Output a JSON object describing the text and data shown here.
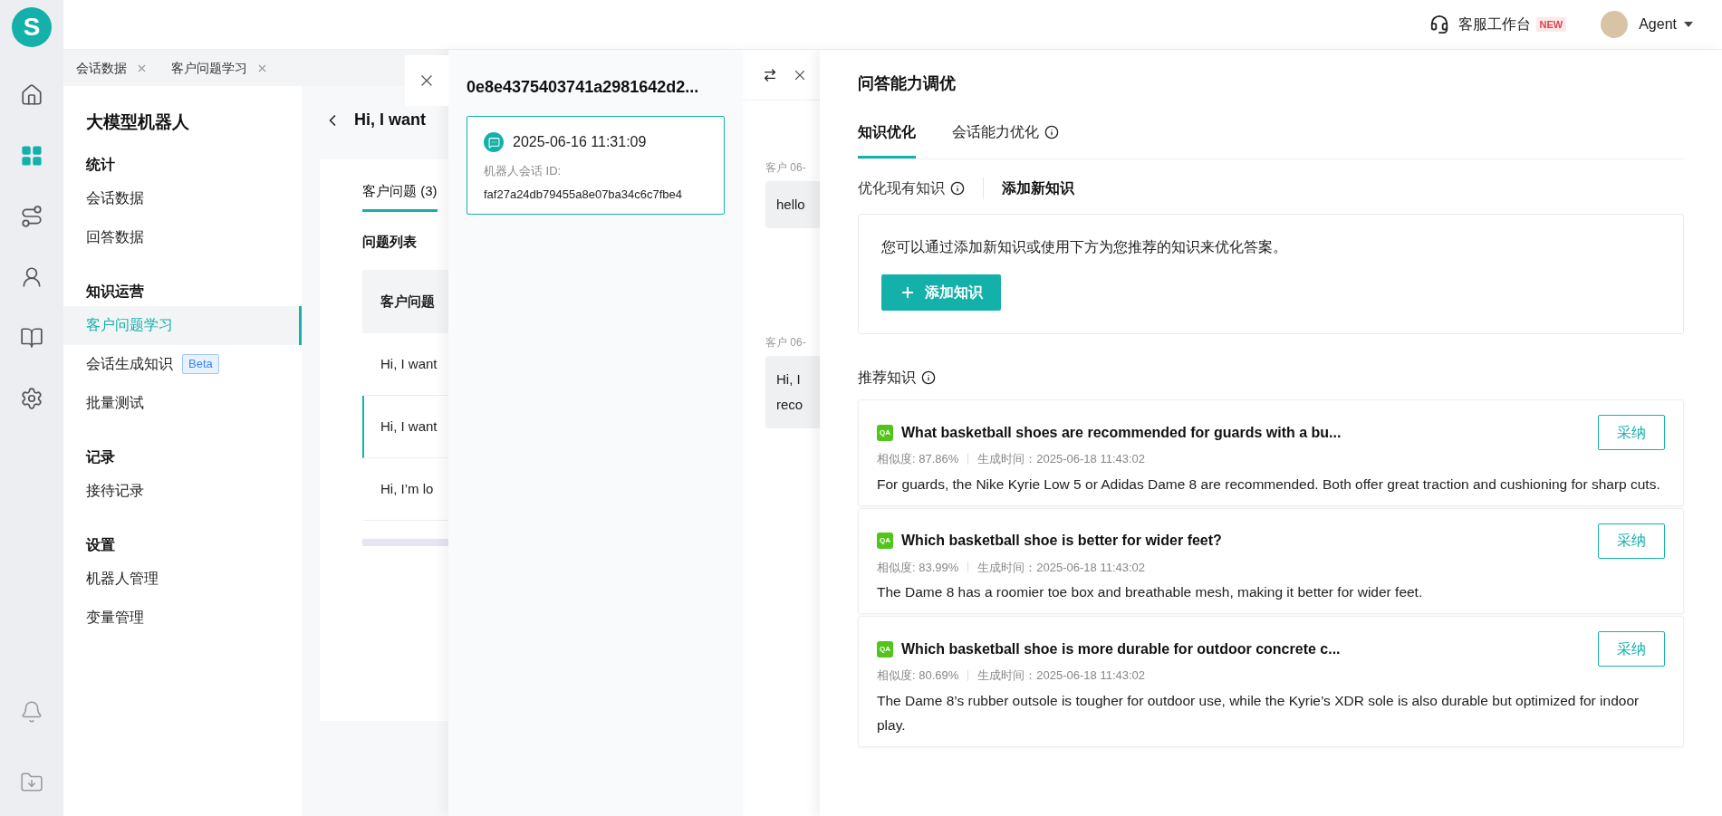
{
  "brand": {
    "letter": "S"
  },
  "rail_items": [
    {
      "selected": false
    },
    {
      "selected": true
    },
    {
      "selected": false
    },
    {
      "selected": false
    },
    {
      "selected": false
    },
    {
      "selected": false
    }
  ],
  "top_bar": {
    "workspace": "客服工作台",
    "badge": "NEW",
    "user": "Agent"
  },
  "page_tabs": [
    {
      "label": "会话数据"
    },
    {
      "label": "客户问题学习"
    }
  ],
  "nav": {
    "title": "大模型机器人",
    "sections": [
      {
        "heading": "统计",
        "items": [
          {
            "label": "会话数据",
            "selected": false
          },
          {
            "label": "回答数据",
            "selected": false
          }
        ]
      },
      {
        "heading": "知识运营",
        "items": [
          {
            "label": "客户问题学习",
            "selected": true
          },
          {
            "label": "会话生成知识",
            "selected": false,
            "badge": "Beta"
          },
          {
            "label": "批量测试",
            "selected": false
          }
        ]
      },
      {
        "heading": "记录",
        "items": [
          {
            "label": "接待记录",
            "selected": false
          }
        ]
      },
      {
        "heading": "设置",
        "items": [
          {
            "label": "机器人管理",
            "selected": false
          },
          {
            "label": "变量管理",
            "selected": false
          }
        ]
      }
    ]
  },
  "detail": {
    "title": "Hi, I want",
    "tabs": [
      {
        "label": "客户问题 (3)",
        "selected": true
      }
    ],
    "list_title": "问题列表",
    "column_1": "客户问题",
    "rows": [
      {
        "text": "Hi, I want",
        "selected": false
      },
      {
        "text": "Hi, I want",
        "selected": true
      },
      {
        "text": "Hi, I’m lo",
        "selected": false
      }
    ]
  },
  "session_drawer": {
    "title": "0e8e4375403741a2981642d2...",
    "card": {
      "time": "2025-06-16 11:31:09",
      "id_label": "机器人会话 ID:",
      "id": "faf27a24db79455a8e07ba34c6c7fbe4"
    }
  },
  "chat_drawer": {
    "messages": [
      {
        "meta": "客户 06-",
        "text": "hello"
      },
      {
        "meta": "客户 06-",
        "text": "Hi, I",
        "text_2": "reco"
      }
    ]
  },
  "tuning": {
    "title": "问答能力调优",
    "tabs": [
      {
        "label": "知识优化",
        "selected": true,
        "info": false
      },
      {
        "label": "会话能力优化",
        "selected": false,
        "info": true
      }
    ],
    "sub_tabs": [
      {
        "label": "优化现有知识",
        "selected": false,
        "info": true
      },
      {
        "label": "添加新知识",
        "selected": true,
        "info": false
      }
    ],
    "hint": "您可以通过添加新知识或使用下方为您推荐的知识来优化答案。",
    "add_button": "添加知识",
    "recommend_title": "推荐知识",
    "recommendations": [
      {
        "tag": "QA",
        "title": "What basketball shoes are recommended for guards with a bu...",
        "similarity": "相似度: 87.86%",
        "time": "生成时间：2025-06-18 11:43:02",
        "answer": "For guards, the Nike Kyrie Low 5 or Adidas Dame 8 are recommended. Both offer great traction and cushioning for sharp cuts.",
        "action": "采纳"
      },
      {
        "tag": "QA",
        "title": "Which basketball shoe is better for wider feet?",
        "similarity": "相似度: 83.99%",
        "time": "生成时间：2025-06-18 11:43:02",
        "answer": "The Dame 8 has a roomier toe box and breathable mesh, making it better for wider feet.",
        "action": "采纳"
      },
      {
        "tag": "QA",
        "title": "Which basketball shoe is more durable for outdoor concrete c...",
        "similarity": "相似度: 80.69%",
        "time": "生成时间：2025-06-18 11:43:02",
        "answer": "The Dame 8’s rubber outsole is tougher for outdoor use, while the Kyrie’s XDR sole is also durable but optimized for indoor play.",
        "action": "采纳"
      }
    ]
  }
}
